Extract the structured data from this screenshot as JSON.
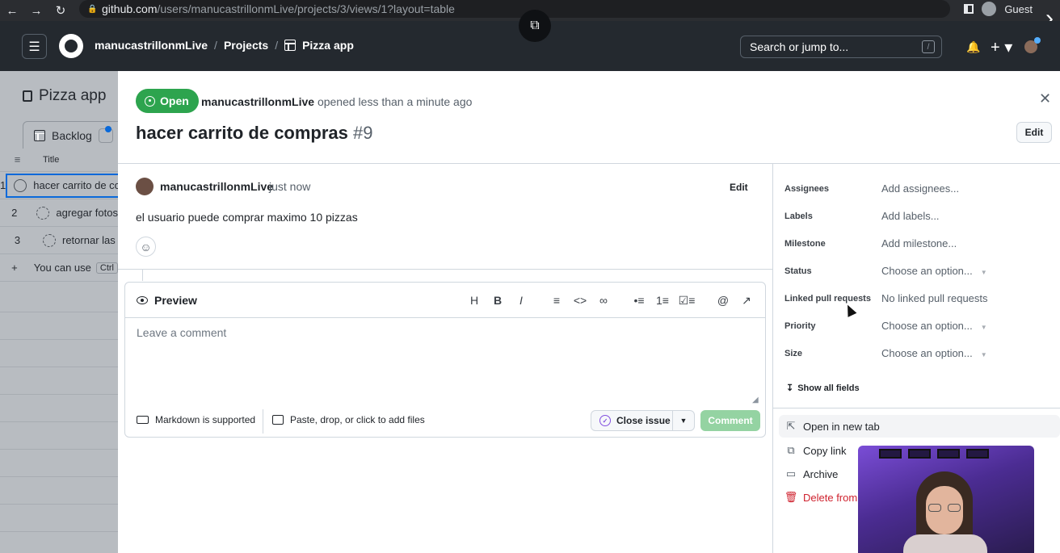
{
  "browser": {
    "url_host": "github.com",
    "url_path": "/users/manucastrillonmLive/projects/3/views/1?layout=table",
    "profile_label": "Guest"
  },
  "header": {
    "user": "manucastrillonmLive",
    "projects": "Projects",
    "project_name": "Pizza app",
    "search_placeholder": "Search or jump to...",
    "search_key": "/"
  },
  "project": {
    "title": "Pizza app",
    "view_tab": "Backlog",
    "column_title": "Title",
    "rows": [
      {
        "num": "1",
        "title": "hacer carrito de compras"
      },
      {
        "num": "2",
        "title": "agregar fotos"
      },
      {
        "num": "3",
        "title": "retornar las"
      }
    ],
    "add_hint": "You can use",
    "add_key": "Ctrl"
  },
  "issue": {
    "state": "Open",
    "author": "manucastrillonmLive",
    "opened": "opened less than a minute ago",
    "title": "hacer carrito de compras",
    "number": "#9",
    "edit_label": "Edit"
  },
  "comment": {
    "author": "manucastrillonmLive",
    "time": "just now",
    "edit_label": "Edit",
    "body": "el usuario puede comprar maximo 10 pizzas"
  },
  "editor": {
    "preview_label": "Preview",
    "placeholder": "Leave a comment",
    "markdown_label": "Markdown is supported",
    "attach_label": "Paste, drop, or click to add files",
    "close_issue_label": "Close issue",
    "comment_label": "Comment",
    "toolbar": [
      "H",
      "B",
      "I",
      "≡",
      "<>",
      "∞",
      "•≡",
      "1≡",
      "☑≡",
      "@",
      "↗"
    ]
  },
  "fields": [
    {
      "label": "Assignees",
      "value": "Add assignees...",
      "dropdown": false
    },
    {
      "label": "Labels",
      "value": "Add labels...",
      "dropdown": false
    },
    {
      "label": "Milestone",
      "value": "Add milestone...",
      "dropdown": false
    },
    {
      "label": "Status",
      "value": "Choose an option...",
      "dropdown": true
    },
    {
      "label": "Linked pull requests",
      "value": "No linked pull requests",
      "dropdown": false
    },
    {
      "label": "Priority",
      "value": "Choose an option...",
      "dropdown": true
    },
    {
      "label": "Size",
      "value": "Choose an option...",
      "dropdown": true
    }
  ],
  "show_all_fields": "Show all fields",
  "actions": {
    "open_new_tab": "Open in new tab",
    "copy_link": "Copy link",
    "archive": "Archive",
    "delete": "Delete from"
  },
  "colors": {
    "open_green": "#2da44e",
    "danger_red": "#cf222e",
    "header_bg": "#24292f"
  }
}
